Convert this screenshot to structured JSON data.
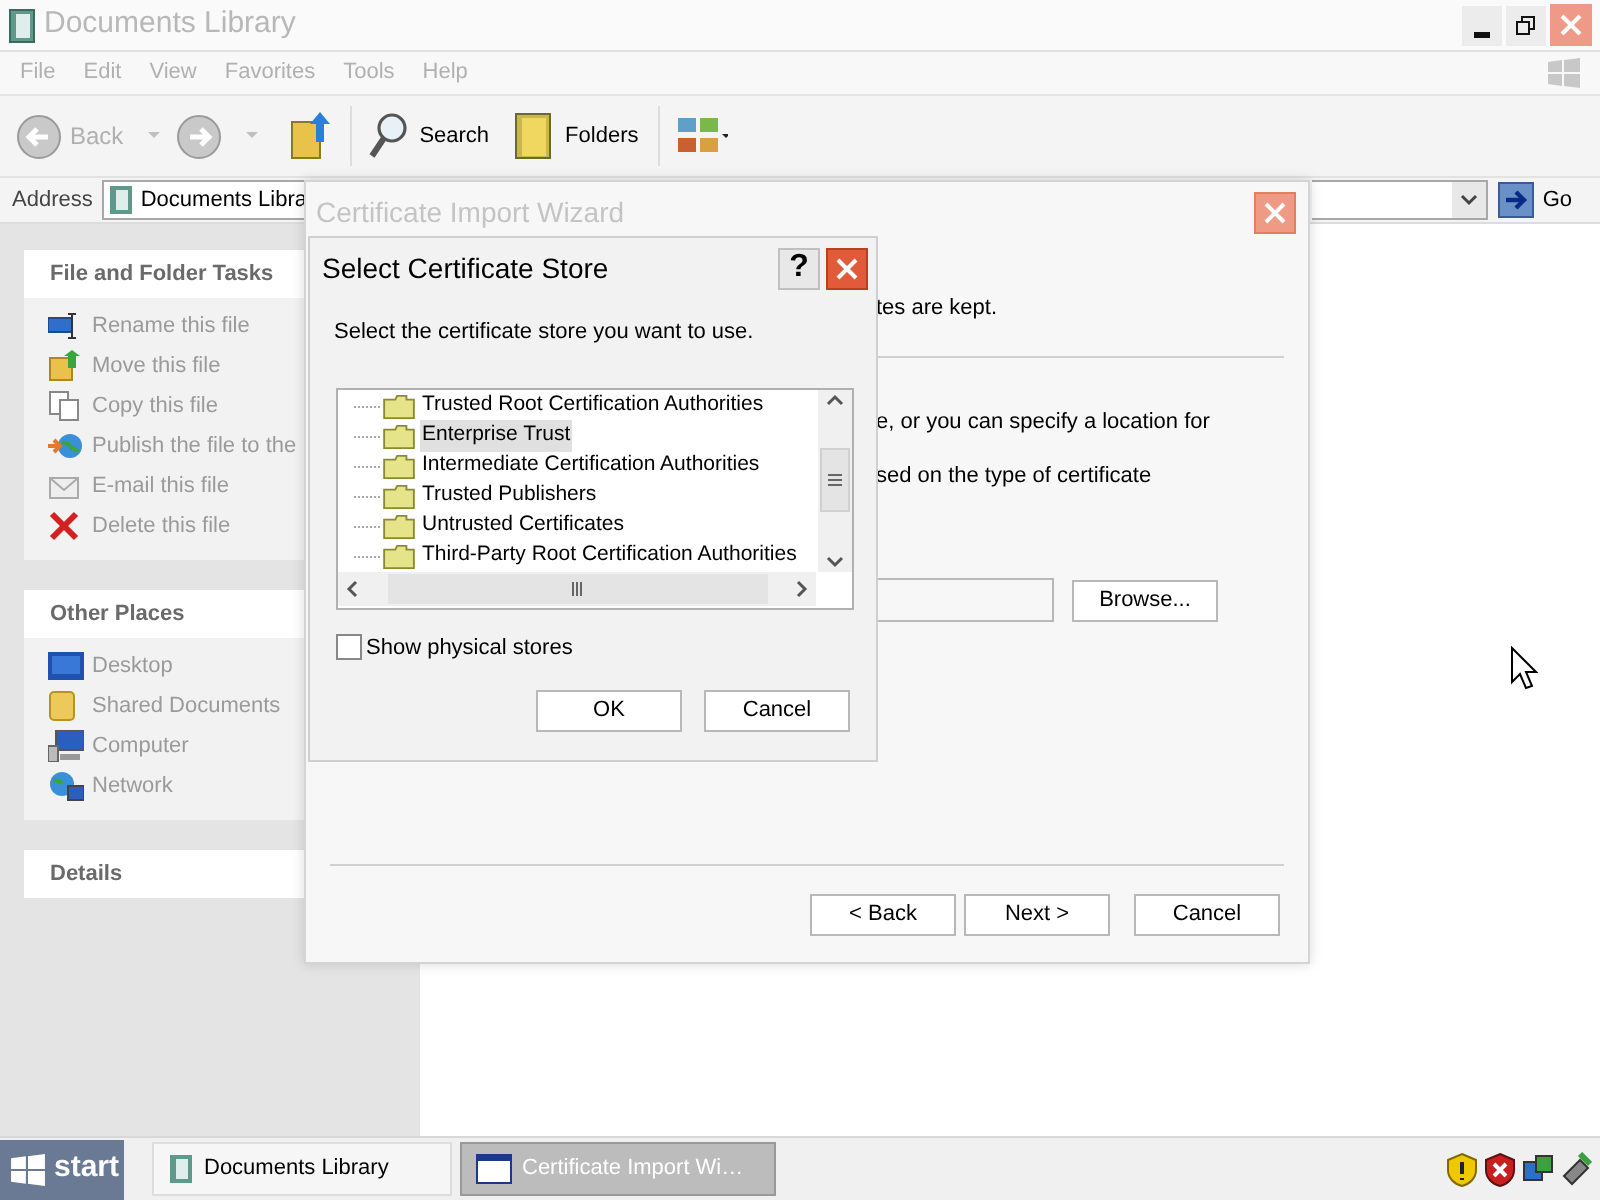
{
  "explorer": {
    "title": "Documents Library",
    "menu": [
      "File",
      "Edit",
      "View",
      "Favorites",
      "Tools",
      "Help"
    ],
    "toolbar": [
      {
        "kind": "back",
        "label": "Back",
        "disabled": true
      },
      {
        "kind": "forward",
        "disabled": true
      },
      {
        "kind": "up"
      },
      {
        "kind": "search",
        "label": "Search"
      },
      {
        "kind": "folders",
        "label": "Folders"
      },
      {
        "kind": "views"
      }
    ],
    "address": {
      "label": "Address",
      "value": "Documents Libra",
      "go": "Go"
    },
    "panels": [
      {
        "title": "File and Folder Tasks",
        "items": [
          {
            "kind": "rename",
            "label": "Rename this file"
          },
          {
            "kind": "move",
            "label": "Move this file"
          },
          {
            "kind": "copy",
            "label": "Copy this file"
          },
          {
            "kind": "publish",
            "label": "Publish the file to the"
          },
          {
            "kind": "email",
            "label": "E-mail this file"
          },
          {
            "kind": "delete",
            "label": "Delete this file"
          }
        ]
      },
      {
        "title": "Other Places",
        "items": [
          {
            "kind": "desktop",
            "label": "Desktop"
          },
          {
            "kind": "shared",
            "label": "Shared Documents"
          },
          {
            "kind": "computer",
            "label": "Computer"
          },
          {
            "kind": "network",
            "label": "Network"
          }
        ]
      },
      {
        "title": "Details"
      }
    ]
  },
  "wizard": {
    "title": "Certificate Import Wizard",
    "text_1": "tes are kept.",
    "text_2": "e, or you can specify a location for",
    "text_3": "sed on the type of certificate",
    "browse": "Browse...",
    "buttons": [
      "< Back",
      "Next >",
      "Cancel"
    ]
  },
  "dialog": {
    "title": "Select Certificate Store",
    "help": "?",
    "prompt": "Select the certificate store you want to use.",
    "stores": [
      {
        "label": "Trusted Root Certification Authorities",
        "selected": false
      },
      {
        "label": "Enterprise Trust",
        "selected": true
      },
      {
        "label": "Intermediate Certification Authorities",
        "selected": false
      },
      {
        "label": "Trusted Publishers",
        "selected": false
      },
      {
        "label": "Untrusted Certificates",
        "selected": false
      },
      {
        "label": "Third-Party Root Certification Authorities",
        "selected": false
      }
    ],
    "show_physical": {
      "label": "Show physical stores",
      "checked": false
    },
    "buttons": [
      "OK",
      "Cancel"
    ]
  },
  "taskbar": {
    "start": "start",
    "tasks": [
      {
        "kind": "folder",
        "label": "Documents Library",
        "selected": false
      },
      {
        "kind": "window",
        "label": "Certificate Import Wi…",
        "selected": true
      }
    ]
  }
}
